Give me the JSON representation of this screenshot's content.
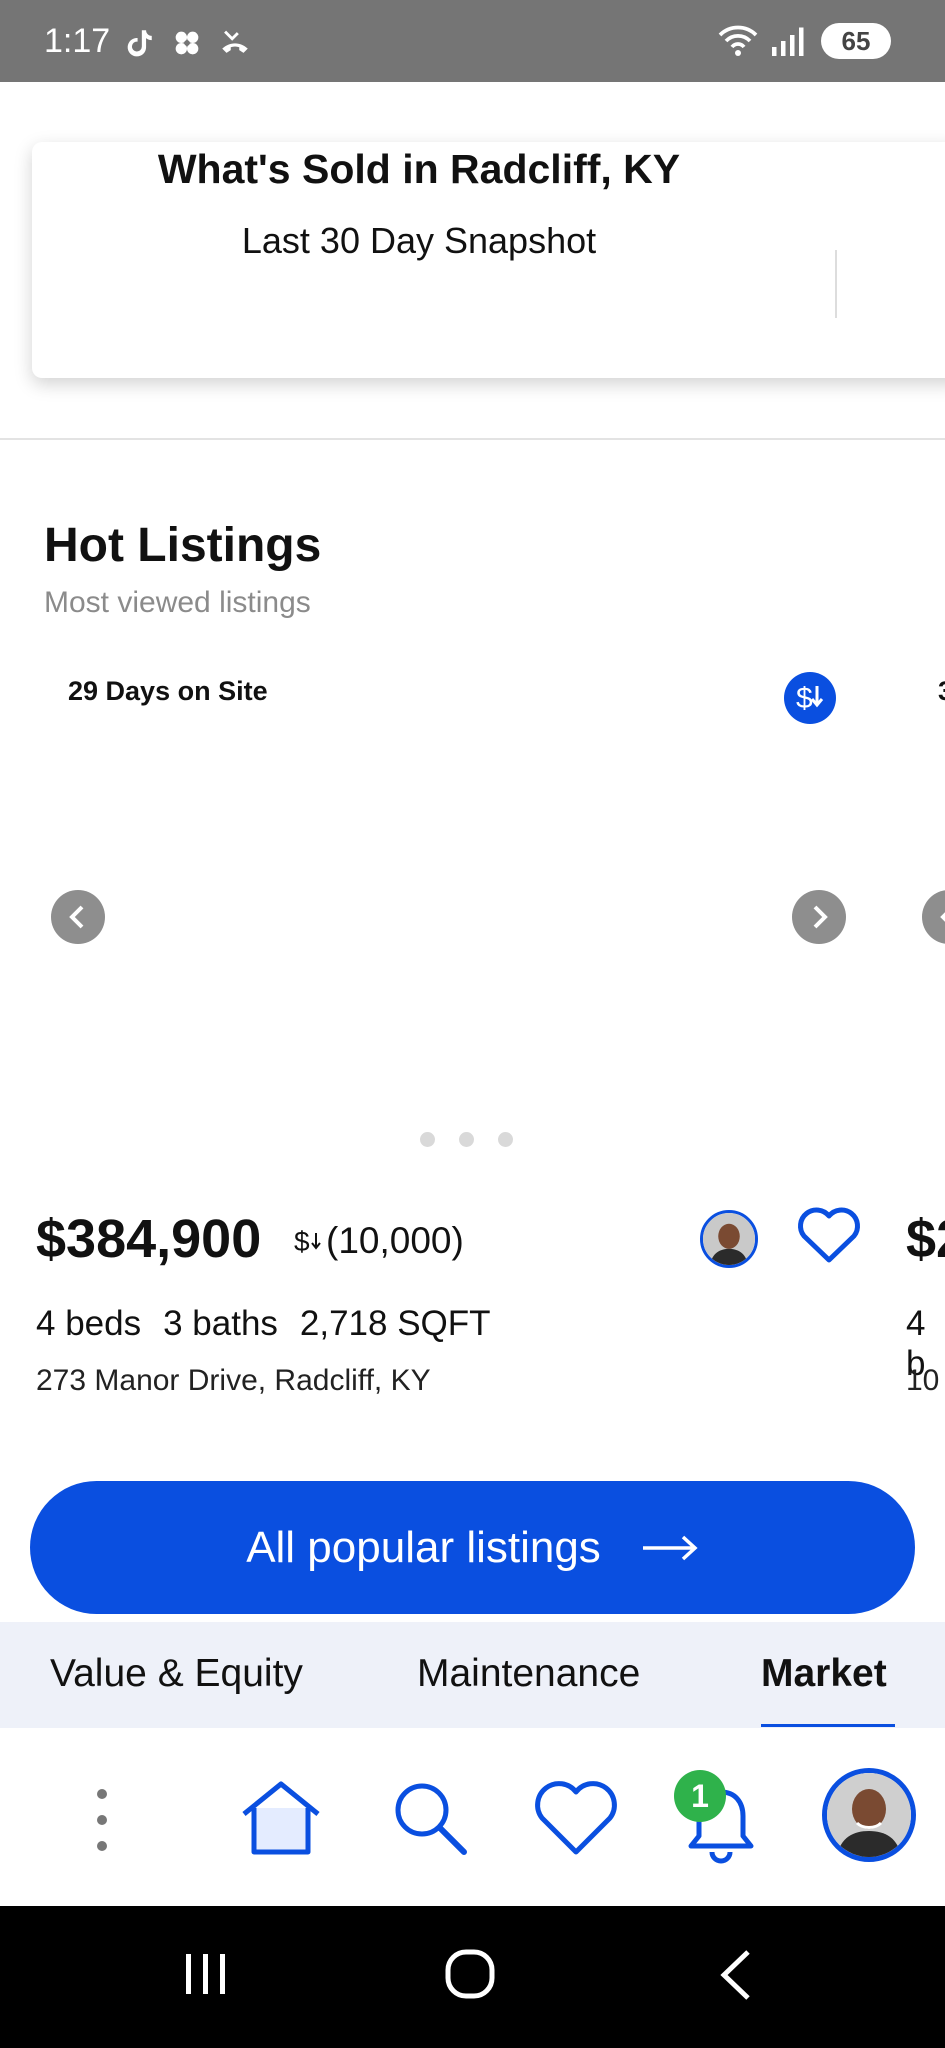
{
  "status_bar": {
    "time": "1:17",
    "battery": "65",
    "notification_icons": [
      "tiktok-icon",
      "pinwheel-icon",
      "missed-call-icon"
    ],
    "system_icons": [
      "wifi-icon",
      "signal-icon",
      "battery-icon"
    ]
  },
  "snapshot": {
    "title": "What's Sold in Radcliff, KY",
    "subtitle": "Last 30 Day Snapshot"
  },
  "hot_listings": {
    "title": "Hot Listings",
    "subtitle": "Most viewed listings",
    "listing": {
      "days_on_site": "29 Days on Site",
      "price": "$384,900",
      "price_change": "(10,000)",
      "beds": "4 beds",
      "baths": "3 baths",
      "sqft": "2,718 SQFT",
      "address": "273 Manor Drive, Radcliff, KY",
      "carousel_dots": 3
    },
    "next_listing_peek": {
      "days_prefix": "3",
      "price_prefix": "$2",
      "specs_prefix": "4 b",
      "address_prefix": "10"
    },
    "cta_label": "All popular listings"
  },
  "tabs": [
    {
      "label": "Value & Equity",
      "active": false
    },
    {
      "label": "Maintenance",
      "active": false
    },
    {
      "label": "Market",
      "active": true
    }
  ],
  "bottom_nav": {
    "items": [
      "more-icon",
      "home-icon",
      "search-icon",
      "favorites-icon",
      "notifications-icon",
      "agent-avatar"
    ],
    "notification_count": "1"
  },
  "colors": {
    "accent": "#0a4fe0",
    "badge_green": "#2fb24b",
    "tab_bg": "#eef1f9",
    "status_bar": "#757575"
  }
}
